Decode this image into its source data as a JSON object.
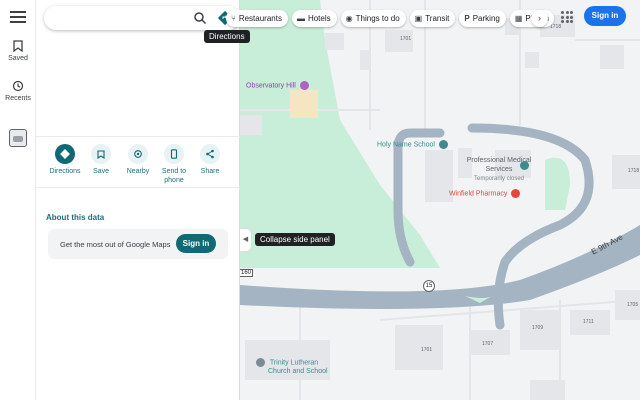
{
  "search": {
    "value": "",
    "placeholder": ""
  },
  "tooltips": {
    "directions": "Directions",
    "collapse": "Collapse side panel"
  },
  "rail": {
    "saved": "Saved",
    "recents": "Recents"
  },
  "chips": [
    {
      "icon": "fork-knife-icon",
      "glyph": "⑂",
      "label": "Restaurants"
    },
    {
      "icon": "bed-icon",
      "glyph": "▬",
      "label": "Hotels"
    },
    {
      "icon": "camera-icon",
      "glyph": "◉",
      "label": "Things to do"
    },
    {
      "icon": "bus-icon",
      "glyph": "▣",
      "label": "Transit"
    },
    {
      "icon": "parking-icon",
      "glyph": "P",
      "label": "Parking"
    },
    {
      "icon": "pharmacy-icon",
      "glyph": "▦",
      "label": "Pharm"
    }
  ],
  "header": {
    "signin": "Sign in"
  },
  "actions": [
    {
      "label": "Directions"
    },
    {
      "label": "Save"
    },
    {
      "label": "Nearby"
    },
    {
      "label": "Send to phone"
    },
    {
      "label": "Share"
    }
  ],
  "about": {
    "heading": "About this data",
    "promo_text": "Get the most out of Google Maps",
    "promo_button": "Sign in"
  },
  "map": {
    "places": {
      "observatory_hill": "Observatory Hill",
      "holy_name_school": "Holy Name School",
      "professional_medical": "Professional Medical Services",
      "temporarily_closed": "Temporarily closed",
      "winfield_pharmacy": "Winfield Pharmacy",
      "trinity_lutheran": "Trinity Lutheran Church and School"
    },
    "street": "E 9th Ave",
    "route_15": "15",
    "route_160": "160",
    "addresses": [
      "1701",
      "1718",
      "1718",
      "1709",
      "1711",
      "1707",
      "1701",
      "1705"
    ],
    "colors": {
      "park": "#c8edd8",
      "road": "#a4b4c2",
      "poi_teal": "#3d8b8f",
      "pharmacy": "#e8453c",
      "park_poi": "#b05fc2"
    }
  }
}
